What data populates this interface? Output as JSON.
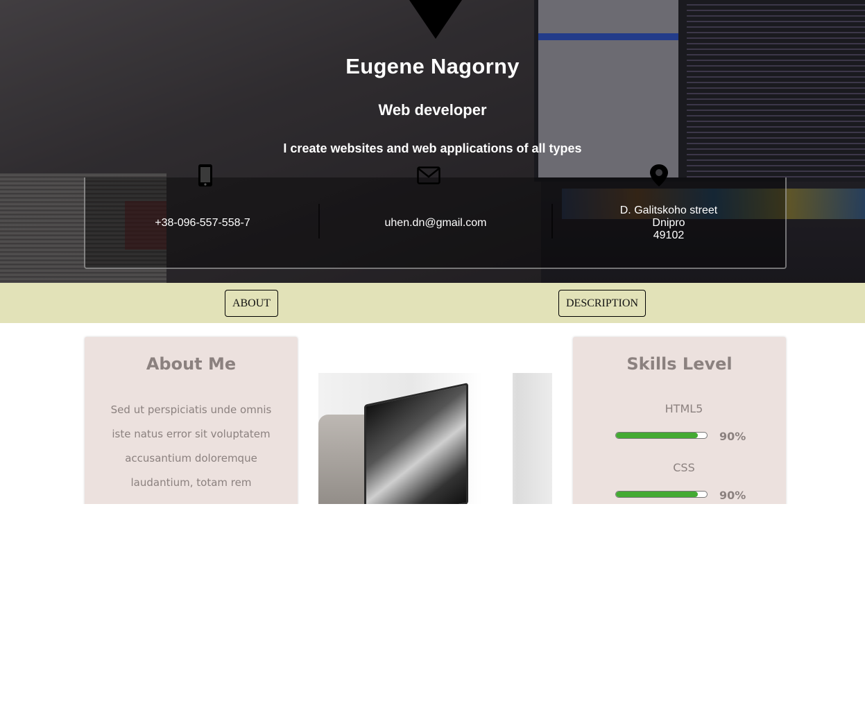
{
  "hero": {
    "name": "Eugene Nagorny",
    "role": "Web developer",
    "tagline": "I create websites and web applications of all types",
    "contacts": {
      "phone": "+38-096-557-558-7",
      "email": "uhen.dn@gmail.com",
      "address": [
        "D. Galitskoho street",
        "Dnipro",
        "49102"
      ]
    }
  },
  "nav": {
    "about_label": "ABOUT",
    "description_label": "DESCRIPTION"
  },
  "about": {
    "title": "About Me",
    "text": "Sed ut perspiciatis unde omnis iste natus error sit voluptatem accusantium doloremque laudantium, totam rem"
  },
  "skills": {
    "title": "Skills Level",
    "items": [
      {
        "name": "HTML5",
        "percent_label": "90%",
        "level": 0.9
      },
      {
        "name": "CSS",
        "percent_label": "90%",
        "level": 0.9
      }
    ]
  },
  "colors": {
    "nav_bg": "#e2e2b8",
    "card_bg": "#ece1de",
    "text_muted": "#8b817f",
    "skill_fill": "#44aa33"
  },
  "icons": {
    "phone": "mobile-phone-icon",
    "email": "envelope-icon",
    "address": "map-pin-icon"
  }
}
